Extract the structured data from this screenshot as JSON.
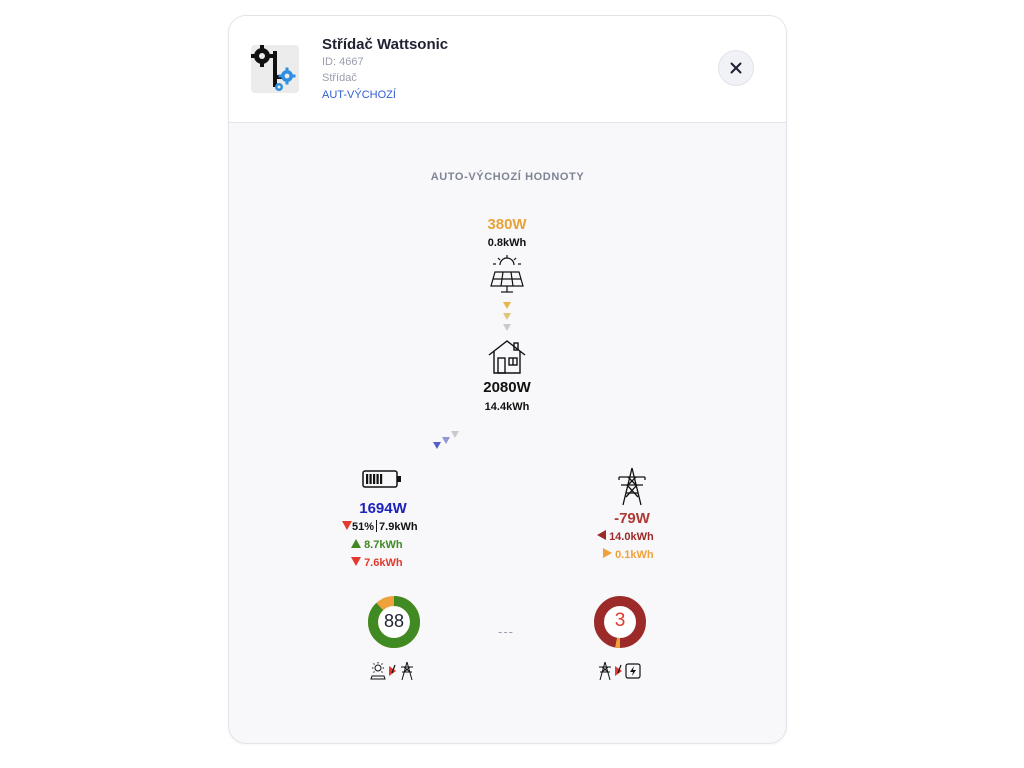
{
  "header": {
    "title": "Střídač Wattsonic",
    "id_text": "ID: 4667",
    "type_text": "Střídač",
    "profile_link": "AUT-VÝCHOZÍ",
    "close_icon": "close-icon"
  },
  "section_title": "AUTO-VÝCHOZÍ HODNOTY",
  "solar": {
    "power": "380W",
    "energy": "0.8kWh",
    "icon": "solar-panel-icon",
    "color": "#e6a33a"
  },
  "house": {
    "power": "2080W",
    "energy": "14.4kWh",
    "icon": "house-icon"
  },
  "battery": {
    "power": "1694W",
    "soc": "51%",
    "soc_energy": "7.9kWh",
    "charged": "8.7kWh",
    "discharged": "7.6kWh",
    "icon": "battery-icon",
    "color": "#1d22b8"
  },
  "grid": {
    "power": "-79W",
    "imported": "14.0kWh",
    "exported": "0.1kWh",
    "icon": "power-tower-icon",
    "color": "#b03a33"
  },
  "scores": {
    "self_sufficiency": {
      "value": "88",
      "fill_fraction": 0.88,
      "icon": "solar-to-grid-icon"
    },
    "separator": "---",
    "grid_dependency": {
      "value": "3",
      "fill_fraction": 0.03,
      "icon": "grid-to-meter-icon"
    }
  },
  "colors": {
    "green": "#3f8a22",
    "red": "#e23a2c",
    "dark_red": "#9b2a28",
    "orange": "#efa13b",
    "blue_arrow": "#5360c8"
  }
}
